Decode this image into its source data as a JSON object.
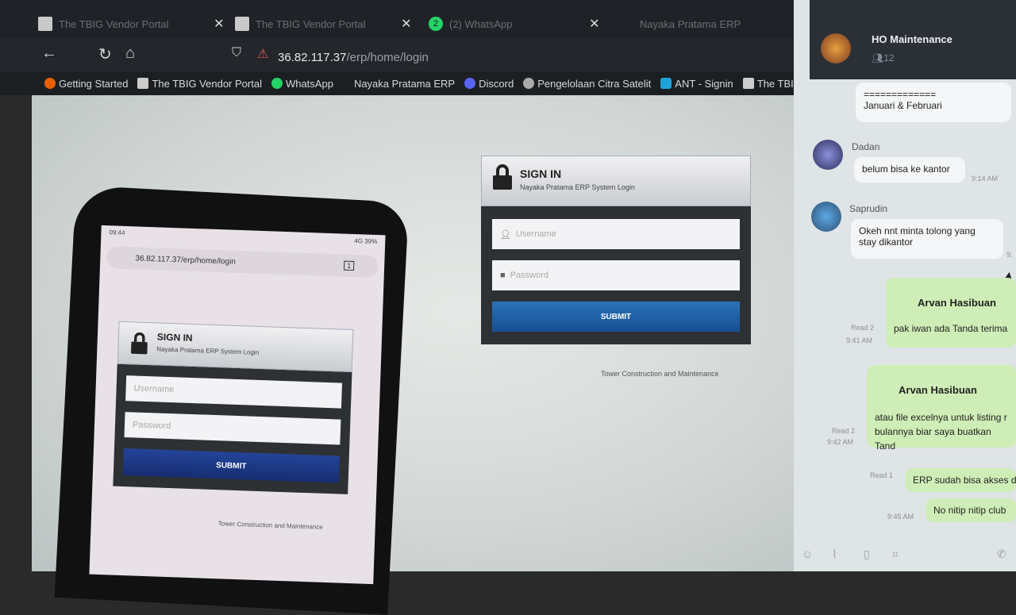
{
  "browser": {
    "tabs": [
      {
        "label": "The TBIG Vendor Portal"
      },
      {
        "label": "The TBIG Vendor Portal"
      },
      {
        "label": "(2) WhatsApp",
        "badge": "2"
      },
      {
        "label": "Nayaka Pratama ERP"
      }
    ],
    "close_glyph": "✕",
    "url_host": "36.82.117.37",
    "url_path": "/erp/home/login",
    "bookmarks": [
      "Getting Started",
      "The TBIG Vendor Portal",
      "WhatsApp",
      "Nayaka Pratama ERP",
      "Discord",
      "Pengelolaan Citra Satelit",
      "ANT - Signin",
      "The TBIG"
    ]
  },
  "login": {
    "title": "SIGN IN",
    "subtitle": "Nayaka Pratama ERP System Login",
    "username_placeholder": "Username",
    "password_placeholder": "Password",
    "submit_label": "SUBMIT",
    "footer": "Tower Construction and Maintenance"
  },
  "phone": {
    "status_time": "09:44",
    "status_right": "4G 39%",
    "url": "36.82.117.37/erp/home/login",
    "tab_count": "1"
  },
  "chat": {
    "group_name": "HO Maintenance",
    "member_count": "12",
    "messages": [
      {
        "text": "=============\nJanuari & Februari"
      },
      {
        "sender": "Dadan",
        "text": "belum bisa ke kantor",
        "time": "9:14 AM"
      },
      {
        "sender": "Saprudin",
        "text": "Okeh nnt minta tolong yang stay dikantor",
        "time": "9:"
      },
      {
        "sender": "Arvan Hasibuan",
        "text": "pak iwan ada Tanda terima",
        "status": "Read 2",
        "time": "9:41 AM"
      },
      {
        "sender": "Arvan Hasibuan",
        "text": "atau file excelnya untuk listing r bulannya biar saya buatkan Tand",
        "status": "Read 2",
        "time": "9:42 AM"
      },
      {
        "text": "ERP sudah bisa akses d",
        "status": "Read 1"
      },
      {
        "text": "No nitip nitip club",
        "time": "9:45 AM"
      }
    ]
  },
  "colors": {
    "submit_blue": "#1e5fa8",
    "chat_bg": "#dfe4e6",
    "outgoing_bubble": "#cfeeb7"
  }
}
